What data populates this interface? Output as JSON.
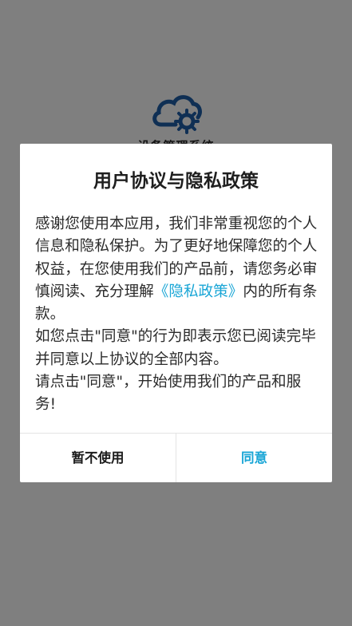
{
  "app": {
    "name": "设备管理系统",
    "logo_icon": "cloud-gear-icon",
    "logo_color": "#1f5fa8"
  },
  "dialog": {
    "title": "用户协议与隐私政策",
    "paragraph1_before_link": "感谢您使用本应用，我们非常重视您的个人信息和隐私保护。为了更好地保障您的个人权益，在您使用我们的产品前，请您务必审慎阅读、充分理解",
    "policy_link": "《隐私政策》",
    "paragraph1_after_link": "内的所有条款。",
    "paragraph2": "如您点击\"同意\"的行为即表示您已阅读完毕并同意以上协议的全部内容。",
    "paragraph3": "请点击\"同意\"，开始使用我们的产品和服务!",
    "decline_label": "暂不使用",
    "agree_label": "同意",
    "accent_color": "#1aa6d6"
  },
  "colors": {
    "overlay": "rgba(0,0,0,0.5)",
    "dialog_bg": "#ffffff"
  }
}
